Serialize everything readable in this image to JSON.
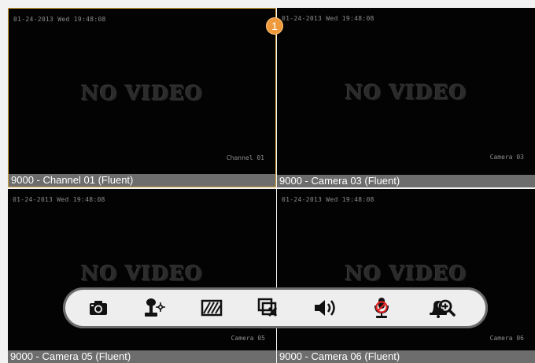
{
  "tiles": [
    {
      "timestamp": "01-24-2013 Wed 19:48:08",
      "message": "NO VIDEO",
      "overlay_label": "Channel 01",
      "caption": "9000 - Channel 01 (Fluent)",
      "selected": true
    },
    {
      "timestamp": "01-24-2013 Wed 19:48:08",
      "message": "NO VIDEO",
      "overlay_label": "Camera 03",
      "caption": "9000 - Camera 03 (Fluent)",
      "selected": false
    },
    {
      "timestamp": "01-24-2013 Wed 19:48:08",
      "message": "NO VIDEO",
      "overlay_label": "Camera 05",
      "caption": "9000 - Camera 05 (Fluent)",
      "selected": false
    },
    {
      "timestamp": "01-24-2013 Wed 19:48:08",
      "message": "NO VIDEO",
      "overlay_label": "Camera 06",
      "caption": "9000 - Camera 06 (Fluent)",
      "selected": false
    }
  ],
  "badge": {
    "number": "1",
    "color": "#ee9a3c"
  },
  "toolbar": {
    "buttons": [
      {
        "icon": "camera-icon",
        "action": "snapshot"
      },
      {
        "icon": "ptz-icon",
        "action": "ptz"
      },
      {
        "icon": "image-quality-icon",
        "action": "quality"
      },
      {
        "icon": "close-window-icon",
        "action": "stop-window"
      },
      {
        "icon": "speaker-icon",
        "action": "audio"
      },
      {
        "icon": "mic-disabled-icon",
        "action": "talk"
      },
      {
        "icon": "alarm-icon",
        "action": "alarm"
      },
      {
        "icon": "zoom-in-icon",
        "action": "zoom"
      }
    ]
  },
  "colors": {
    "selected_border": "#d6a53b",
    "caption_bg": "#6d6d6d",
    "accent_red": "#e02020"
  }
}
